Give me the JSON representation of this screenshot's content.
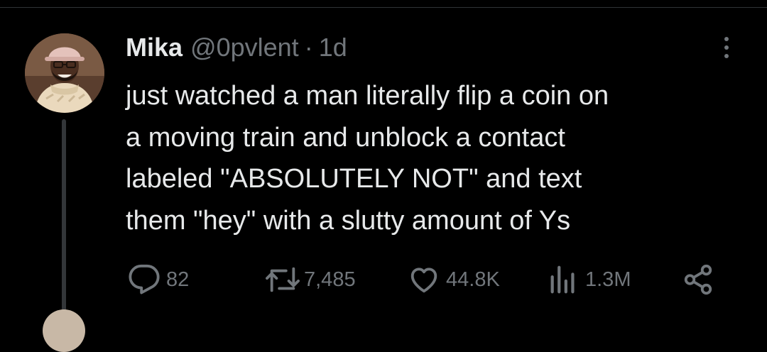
{
  "tweet": {
    "author": {
      "display_name": "Mika",
      "handle": "@0pvlent",
      "separator": "·",
      "time": "1d"
    },
    "text_lines": [
      "just watched a man literally flip a coin on",
      "a moving train and unblock a contact",
      "labeled \"ABSOLUTELY NOT\" and text",
      "them \"hey\" with a slutty amount of Ys"
    ],
    "actions": {
      "replies": {
        "icon": "reply-icon",
        "count": "82"
      },
      "reposts": {
        "icon": "repost-icon",
        "count": "7,485"
      },
      "likes": {
        "icon": "heart-icon",
        "count": "44.8K"
      },
      "views": {
        "icon": "views-icon",
        "count": "1.3M"
      },
      "share": {
        "icon": "share-icon"
      }
    }
  },
  "colors": {
    "background": "#000000",
    "primary_text": "#e7e9ea",
    "secondary_text": "#71767b",
    "thread_line": "#333639"
  }
}
